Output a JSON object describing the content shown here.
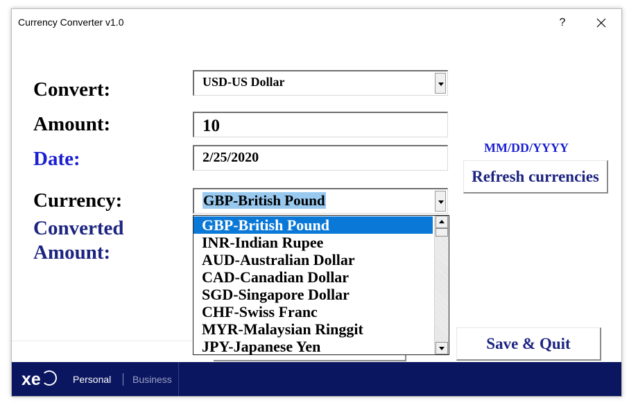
{
  "window": {
    "title": "Currency Converter v1.0",
    "help_glyph": "?"
  },
  "form": {
    "convert_label": "Convert:",
    "amount_label": "Amount:",
    "date_label": "Date:",
    "currency_label": "Currency:",
    "converted_label_line1": "Converted",
    "converted_label_line2": "Amount:",
    "convert_value": "USD-US Dollar",
    "amount_value": "10",
    "date_value": "2/25/2020",
    "currency_value": "GBP-British Pound",
    "date_format_hint": "MM/DD/YYYY"
  },
  "buttons": {
    "refresh_label": "Refresh currencies",
    "save_quit_label": "Save & Quit"
  },
  "currency_list": {
    "items": [
      "GBP-British Pound",
      "INR-Indian Rupee",
      "AUD-Australian Dollar",
      "CAD-Canadian Dollar",
      "SGD-Singapore Dollar",
      "CHF-Swiss Franc",
      "MYR-Malaysian Ringgit",
      "JPY-Japanese Yen"
    ],
    "selected_index": 0
  },
  "footer": {
    "logo_text": "xe",
    "personal_label": "Personal",
    "business_label": "Business"
  },
  "colors": {
    "label_blue": "#1a1fd1",
    "label_navy": "#1c2480",
    "footer_bg": "#0b1660",
    "selection": "#0a78d7"
  },
  "icons": [
    "close-icon",
    "dropdown-arrow-icon",
    "scroll-up-icon",
    "scroll-down-icon",
    "xe-logo"
  ]
}
